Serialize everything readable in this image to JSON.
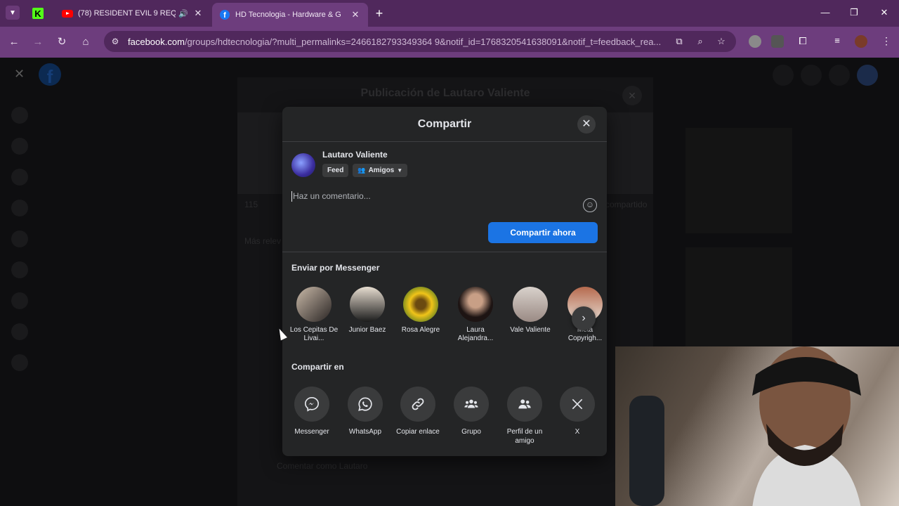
{
  "browser": {
    "tabs": [
      {
        "title": "(78) RESIDENT EVIL 9 REQU",
        "favicon": "youtube-icon",
        "audio": true
      },
      {
        "title": "HD Tecnologia - Hardware & G",
        "favicon": "facebook-icon",
        "active": true
      }
    ],
    "url_domain": "facebook.com",
    "url_path": "/groups/hdtecnologia/?multi_permalinks=2466182793349364 9&notif_id=1768320541638091&notif_t=feedback_rea..."
  },
  "background": {
    "post_title": "Publicación de Lautaro Valiente",
    "count": "115",
    "shared_text": "compartido",
    "most_relevant": "Más relev",
    "comment_placeholder": "Comentar como Lautaro"
  },
  "share_dialog": {
    "title": "Compartir",
    "author_name": "Lautaro Valiente",
    "feed_chip": "Feed",
    "audience_chip": "Amigos",
    "comment_placeholder": "Haz un comentario...",
    "share_now": "Compartir ahora",
    "messenger_section": "Enviar por Messenger",
    "contacts": [
      {
        "name": "Los Cepitas De Livai..."
      },
      {
        "name": "Junior Baez"
      },
      {
        "name": "Rosa Alegre"
      },
      {
        "name": "Laura Alejandra..."
      },
      {
        "name": "Vale Valiente"
      },
      {
        "name": "Meta Copyrigh..."
      }
    ],
    "share_in_section": "Compartir en",
    "targets": [
      {
        "label": "Messenger",
        "icon": "messenger-icon"
      },
      {
        "label": "WhatsApp",
        "icon": "whatsapp-icon"
      },
      {
        "label": "Copiar enlace",
        "icon": "link-icon"
      },
      {
        "label": "Grupo",
        "icon": "group-icon"
      },
      {
        "label": "Perfil de un amigo",
        "icon": "friend-profile-icon"
      },
      {
        "label": "X",
        "icon": "x-logo-icon"
      }
    ]
  },
  "colors": {
    "browser_frame": "#50285c",
    "browser_toolbar": "#6d3d7d",
    "dialog_bg": "#242526",
    "primary_button": "#1b74e4"
  }
}
